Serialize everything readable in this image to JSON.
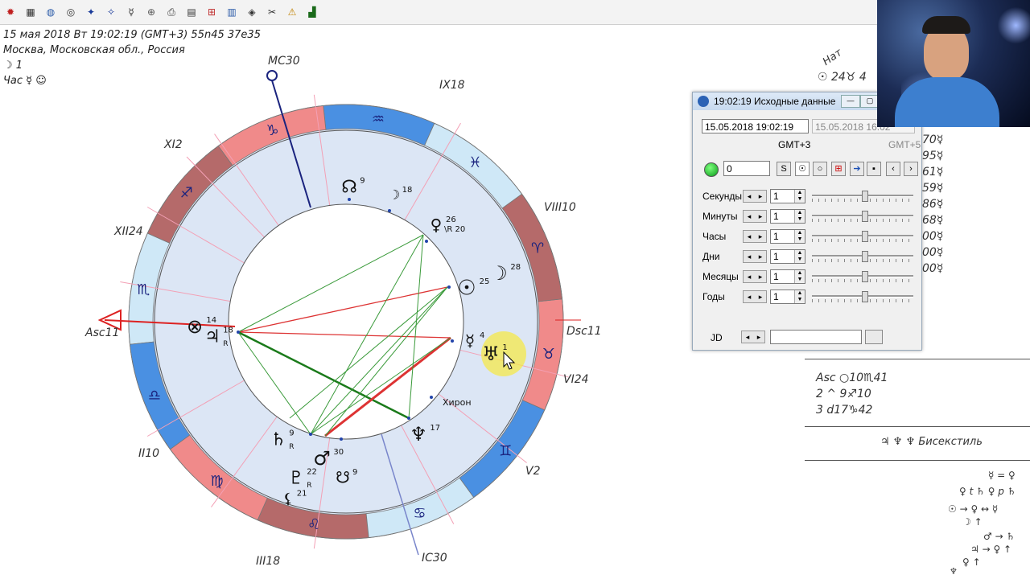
{
  "toolbar": {
    "icons": [
      "app-icon",
      "table-icon",
      "globe-icon",
      "chart-wheel-icon",
      "star-map-icon",
      "sky-icon",
      "planet-icon",
      "wheel-icon",
      "print-icon",
      "document-icon",
      "chart-icon",
      "calendar-icon",
      "settings-icon",
      "tools-icon",
      "warning-icon",
      "graph-icon"
    ],
    "glyphs": [
      "✹",
      "▦",
      "◍",
      "◎",
      "✦",
      "✧",
      "☿",
      "⊕",
      "⎙",
      "▤",
      "⊞",
      "▥",
      "◈",
      "✂",
      "⚠",
      "▟"
    ]
  },
  "chart_info": {
    "line1": "15 мая 2018  Вт  19:02:19 (GMT+3) 55n45  37e35",
    "line2": "Москва, Московская обл., Россия",
    "line3": "☽  1",
    "line4": "Час ☿ ☺"
  },
  "wheel": {
    "house_labels": {
      "mc": "MC30",
      "ix": "IX18",
      "viii": "VIII10",
      "dsc": "Dsc11",
      "vi": "VI24",
      "v": "V2",
      "ic": "IC30",
      "iii": "III18",
      "ii": "II10",
      "asc": "Asc11",
      "xii": "XII24",
      "xi": "XI2"
    },
    "zodiac_glyphs": [
      "♈",
      "♉",
      "♊",
      "♋",
      "♌",
      "♍",
      "♎",
      "♏",
      "♐",
      "♑",
      "♒",
      "♓"
    ],
    "planets": {
      "node": {
        "glyph": "☊",
        "deg": "9"
      },
      "moon_small": {
        "glyph": "☽",
        "deg": "18"
      },
      "venus": {
        "glyph": "♀",
        "deg": "26",
        "extra": "\\R 20"
      },
      "moon": {
        "glyph": "☽",
        "deg": "28"
      },
      "sun": {
        "glyph": "☉",
        "deg": "25"
      },
      "mercury": {
        "glyph": "☿",
        "deg": "4"
      },
      "uranus": {
        "glyph": "♅",
        "deg": "1"
      },
      "neptune": {
        "glyph": "♆",
        "deg": "17"
      },
      "chiron": {
        "label": "Хирон"
      },
      "mars": {
        "glyph": "♂",
        "deg": "30"
      },
      "southnode": {
        "glyph": "☋",
        "deg": "9"
      },
      "saturn": {
        "glyph": "♄",
        "deg": "9",
        "r": "R"
      },
      "pluto": {
        "glyph": "♇",
        "deg": "22",
        "r": "R"
      },
      "lilith": {
        "glyph": "⚸",
        "deg": "21"
      },
      "jupiter": {
        "glyph": "♃",
        "deg": "18",
        "r": "R"
      },
      "fortune": {
        "glyph": "⊗",
        "deg": "14"
      }
    }
  },
  "right_panel": {
    "nat_label": "Нат",
    "rows": [
      "☉  24♉ 4",
      "70☿",
      "95☿",
      "61☿",
      "59☿",
      "86☿",
      "68☿",
      "00☿",
      "00☿",
      "00☿"
    ],
    "asc_line": "Asc ○10♏41",
    "line2": "2  ^  9♐10",
    "line3": "3  d17♑42",
    "bissextile": "♃ ♆ ♆  Бисекстиль",
    "rel1": "☿ = ♀",
    "rel2": "♀ t ♄  ♀ p ♄",
    "rel3": "☉ → ♀ ↔ ☿",
    "rel4": "☽ ↑",
    "rel5": "♂ → ♄",
    "rel6": "♃ → ♀ ↑",
    "rel7": "♀ ↑",
    "rel8": "♆"
  },
  "dialog": {
    "title": "19:02:19 Исходные данные",
    "date1": "15.05.2018   19:02:19",
    "date2": "15.05.2018   16:02",
    "gmt1": "GMT+3",
    "gmt2": "GMT+5",
    "zero": "0",
    "rows": [
      {
        "label": "Секунды",
        "value": "1"
      },
      {
        "label": "Минуты",
        "value": "1"
      },
      {
        "label": "Часы",
        "value": "1"
      },
      {
        "label": "Дни",
        "value": "1"
      },
      {
        "label": "Месяцы",
        "value": "1"
      },
      {
        "label": "Годы",
        "value": "1"
      }
    ],
    "jd_label": "JD",
    "jd_value": ""
  }
}
